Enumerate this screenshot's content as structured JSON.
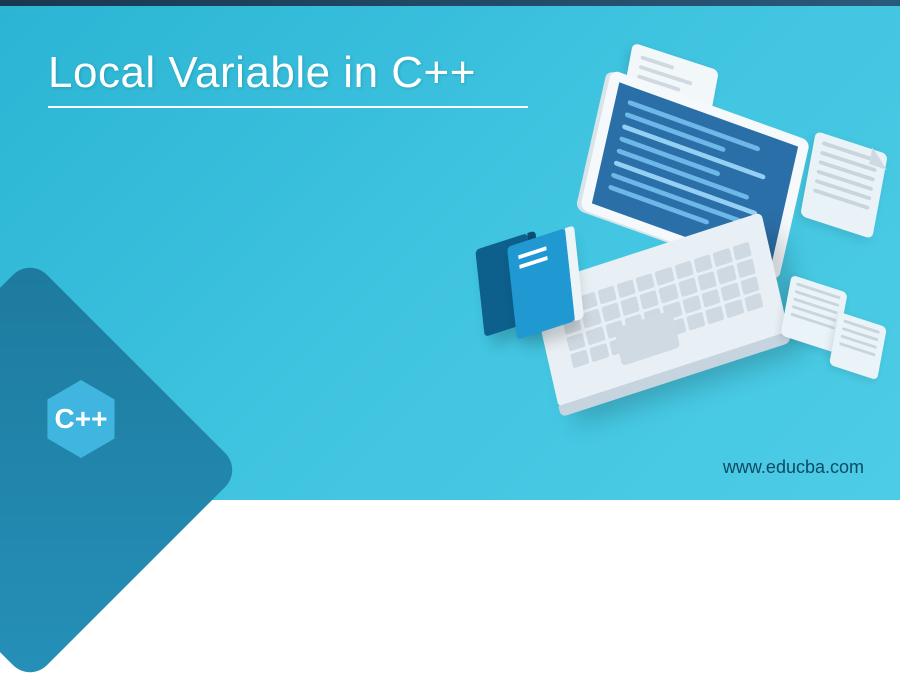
{
  "title": "Local Variable in C++",
  "badge_label": "C++",
  "website": "www.educba.com",
  "illustration": {
    "laptop_icon": "laptop",
    "books_icon": "books",
    "document_icon": "document-page"
  }
}
